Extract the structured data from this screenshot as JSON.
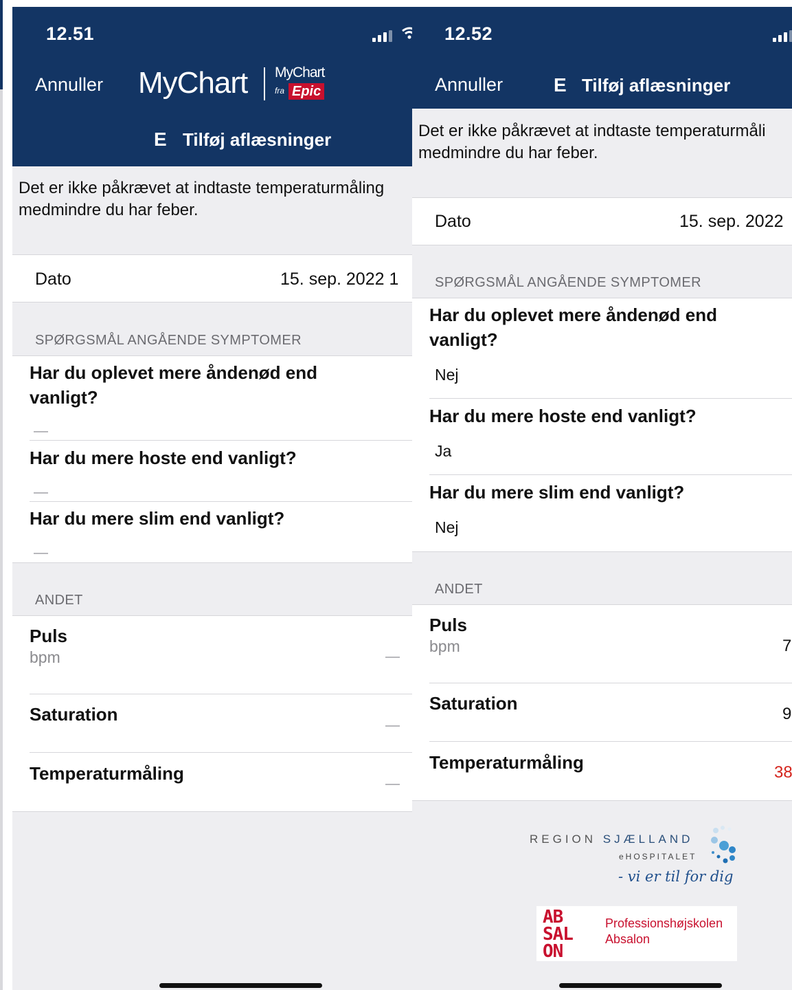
{
  "left_screen": {
    "status": {
      "time": "12.51"
    },
    "nav": {
      "cancel_label": "Annuller",
      "brand": "MyChart",
      "brand_small": "MyChart",
      "brand_fra": "fra",
      "brand_epic": "Epic",
      "title_icon": "E",
      "title": "Tilføj aflæsninger"
    },
    "notice": "Det er ikke påkrævet at indtaste temperaturmåling medmindre du har feber.",
    "date": {
      "label": "Dato",
      "value": "15. sep. 2022 1"
    },
    "symptoms": {
      "header": "SPØRGSMÅL ANGÅENDE SYMPTOMER",
      "questions": [
        {
          "question": "Har du oplevet mere åndenød end vanligt?",
          "answer": ""
        },
        {
          "question": "Har du mere hoste end vanligt?",
          "answer": ""
        },
        {
          "question": "Har du mere slim end vanligt?",
          "answer": ""
        }
      ]
    },
    "other": {
      "header": "ANDET",
      "items": [
        {
          "name": "Puls",
          "unit": "bpm",
          "value": ""
        },
        {
          "name": "Saturation",
          "unit": "",
          "value": ""
        },
        {
          "name": "Temperaturmåling",
          "unit": "",
          "value": ""
        }
      ]
    }
  },
  "right_screen": {
    "status": {
      "time": "12.52"
    },
    "nav": {
      "cancel_label": "Annuller",
      "title_icon": "E",
      "title": "Tilføj aflæsninger"
    },
    "notice": "Det er ikke påkrævet at indtaste temperaturmåli medmindre du har feber.",
    "date": {
      "label": "Dato",
      "value": "15. sep. 2022"
    },
    "symptoms": {
      "header": "SPØRGSMÅL ANGÅENDE SYMPTOMER",
      "questions": [
        {
          "question": "Har du oplevet mere åndenød end vanligt?",
          "answer": "Nej"
        },
        {
          "question": "Har du mere hoste end vanligt?",
          "answer": "Ja"
        },
        {
          "question": "Har du mere slim end vanligt?",
          "answer": "Nej"
        }
      ]
    },
    "other": {
      "header": "ANDET",
      "items": [
        {
          "name": "Puls",
          "unit": "bpm",
          "value": "7"
        },
        {
          "name": "Saturation",
          "unit": "",
          "value": "9"
        },
        {
          "name": "Temperaturmåling",
          "unit": "",
          "value": "38",
          "value_color": "#d4241c"
        }
      ]
    }
  },
  "footer": {
    "region_part1": "REGION ",
    "region_part2": "SJÆLLAND",
    "ehospital": "eHOSPITALET",
    "tagline": "- vi er til for dig",
    "absalon_logo": "AB SAL ON",
    "absalon_name": "Professionshøjskolen Absalon"
  },
  "colors": {
    "nav_bg": "#133564",
    "alert_value": "#d4241c",
    "absalon_red": "#c8102e"
  }
}
